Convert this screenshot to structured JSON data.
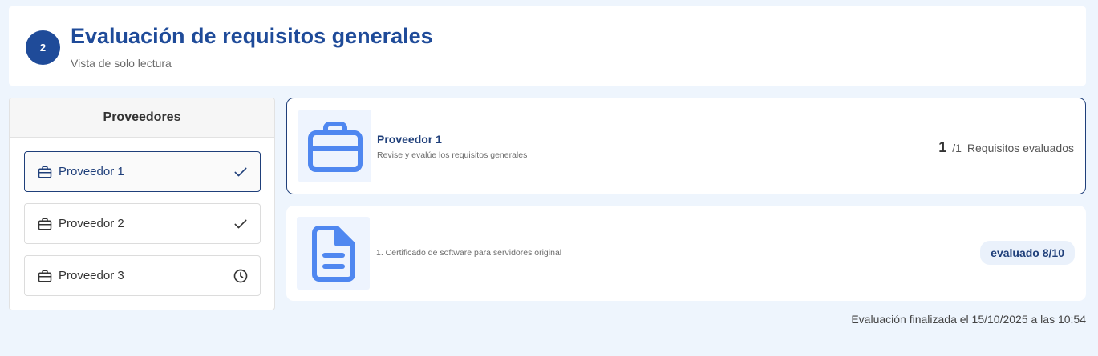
{
  "header": {
    "step_number": "2",
    "title": "Evaluación de requisitos generales",
    "subtitle": "Vista de solo lectura"
  },
  "sidebar": {
    "title": "Proveedores",
    "items": [
      {
        "label": "Proveedor 1",
        "status": "check-icon",
        "active": true
      },
      {
        "label": "Proveedor 2",
        "status": "check-icon",
        "active": false
      },
      {
        "label": "Proveedor 3",
        "status": "clock-icon",
        "active": false
      }
    ]
  },
  "main": {
    "supplier_card": {
      "title": "Proveedor 1",
      "description": "Revise y evalúe los requisitos generales",
      "evaluated": "1",
      "total": "/1",
      "progress_label": "Requisitos evaluados"
    },
    "requirement": {
      "text": "1. Certificado de software para servidores original",
      "score": "evaluado 8/10"
    }
  },
  "footer": {
    "note": "Evaluación finalizada el 15/10/2025 a las 10:54"
  },
  "colors": {
    "brand": "#1f4b99",
    "icon_blue": "#4f87f0",
    "icon_bg": "#eef4fe",
    "page_bg": "#eef5fd"
  }
}
